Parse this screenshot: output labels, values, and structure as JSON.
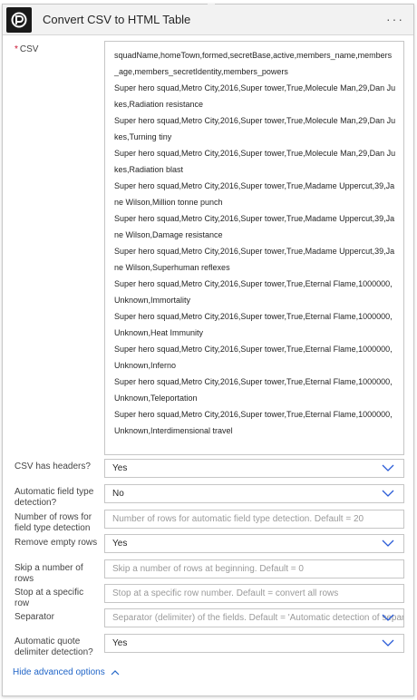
{
  "header": {
    "title": "Convert CSV to HTML Table",
    "menu_label": "···"
  },
  "fields": {
    "csv": {
      "label": "CSV",
      "required_mark": "*",
      "lines": [
        "squadName,homeTown,formed,secretBase,active,members_name,members_age,members_secretIdentity,members_powers",
        "Super hero squad,Metro City,2016,Super tower,True,Molecule Man,29,Dan Jukes,Radiation resistance",
        "Super hero squad,Metro City,2016,Super tower,True,Molecule Man,29,Dan Jukes,Turning tiny",
        "Super hero squad,Metro City,2016,Super tower,True,Molecule Man,29,Dan Jukes,Radiation blast",
        "Super hero squad,Metro City,2016,Super tower,True,Madame Uppercut,39,Jane Wilson,Million tonne punch",
        "Super hero squad,Metro City,2016,Super tower,True,Madame Uppercut,39,Jane Wilson,Damage resistance",
        "Super hero squad,Metro City,2016,Super tower,True,Madame Uppercut,39,Jane Wilson,Superhuman reflexes",
        "Super hero squad,Metro City,2016,Super tower,True,Eternal Flame,1000000,Unknown,Immortality",
        "Super hero squad,Metro City,2016,Super tower,True,Eternal Flame,1000000,Unknown,Heat Immunity",
        "Super hero squad,Metro City,2016,Super tower,True,Eternal Flame,1000000,Unknown,Inferno",
        "Super hero squad,Metro City,2016,Super tower,True,Eternal Flame,1000000,Unknown,Teleportation",
        "Super hero squad,Metro City,2016,Super tower,True,Eternal Flame,1000000,Unknown,Interdimensional travel"
      ]
    },
    "csv_has_headers": {
      "label": "CSV has headers?",
      "value": "Yes"
    },
    "auto_field_type": {
      "label": "Automatic field type detection?",
      "value": "No"
    },
    "rows_for_detection": {
      "label": "Number of rows for field type detection",
      "placeholder": "Number of rows for automatic field type detection. Default = 20"
    },
    "remove_empty_rows": {
      "label": "Remove empty rows",
      "value": "Yes"
    },
    "skip_rows": {
      "label": "Skip a number of rows",
      "placeholder": "Skip a number of rows at beginning. Default = 0"
    },
    "stop_at_row": {
      "label": "Stop at a specific row",
      "placeholder": "Stop at a specific row number. Default = convert all rows"
    },
    "separator": {
      "label": "Separator",
      "placeholder": "Separator (delimiter) of the fields. Default = 'Automatic detection of separator'"
    },
    "auto_quote": {
      "label": "Automatic quote delimiter detection?",
      "value": "Yes"
    }
  },
  "advanced": {
    "label": "Hide advanced options"
  },
  "colors": {
    "chevron": "#2a5bd7",
    "link": "#2266c8",
    "required": "#c8102e"
  }
}
